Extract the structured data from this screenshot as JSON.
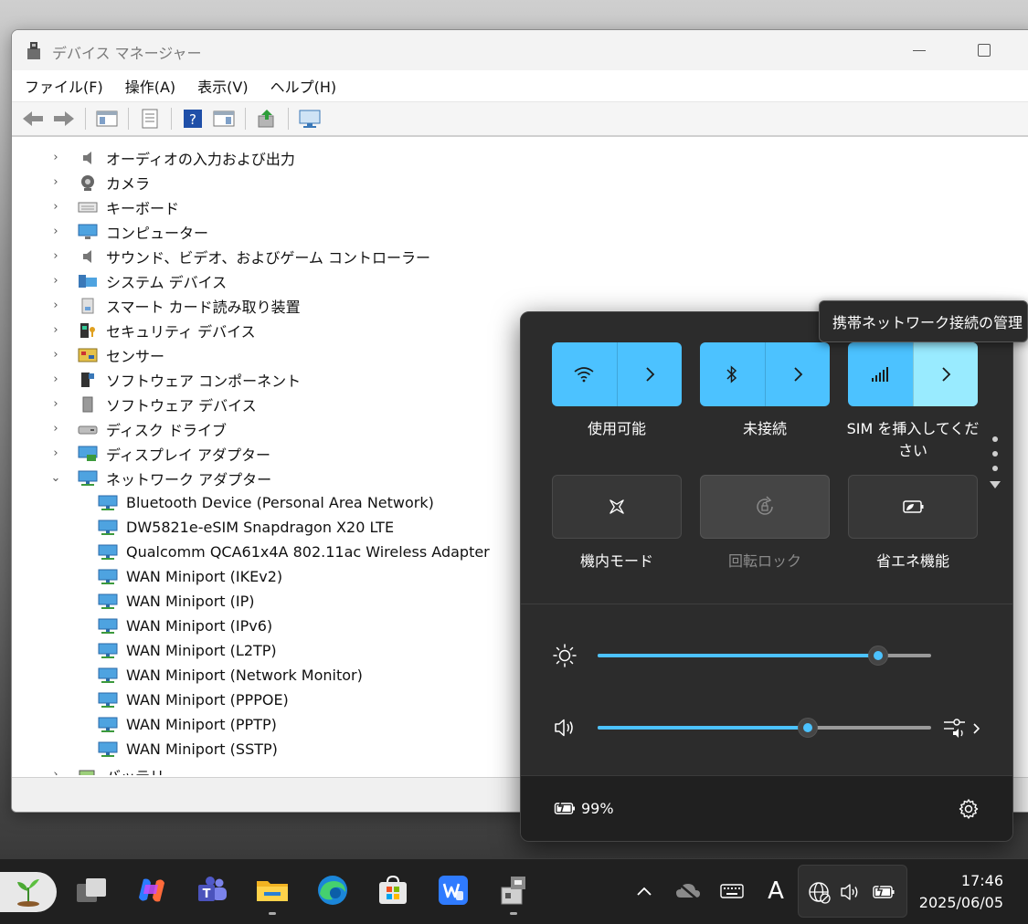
{
  "window": {
    "title": "デバイス マネージャー",
    "menu": [
      "ファイル(F)",
      "操作(A)",
      "表示(V)",
      "ヘルプ(H)"
    ]
  },
  "tree": {
    "categories": [
      "オーディオの入力および出力",
      "カメラ",
      "キーボード",
      "コンピューター",
      "サウンド、ビデオ、およびゲーム コントローラー",
      "システム デバイス",
      "スマート カード読み取り装置",
      "セキュリティ デバイス",
      "センサー",
      "ソフトウェア コンポーネント",
      "ソフトウェア デバイス",
      "ディスク ドライブ",
      "ディスプレイ アダプター",
      "ネットワーク アダプター"
    ],
    "network_adapters": [
      "Bluetooth Device (Personal Area Network)",
      "DW5821e-eSIM Snapdragon X20 LTE",
      "Qualcomm QCA61x4A 802.11ac Wireless Adapter",
      "WAN Miniport (IKEv2)",
      "WAN Miniport (IP)",
      "WAN Miniport (IPv6)",
      "WAN Miniport (L2TP)",
      "WAN Miniport (Network Monitor)",
      "WAN Miniport (PPPOE)",
      "WAN Miniport (PPTP)",
      "WAN Miniport (SSTP)"
    ],
    "partial_category": "バッテリ"
  },
  "quick_settings": {
    "tiles": [
      {
        "label": "使用可能",
        "icon": "wifi-icon",
        "state": "on"
      },
      {
        "label": "未接続",
        "icon": "bluetooth-icon",
        "state": "on"
      },
      {
        "label": "SIM を挿入してください",
        "icon": "cellular-icon",
        "state": "on"
      },
      {
        "label": "機内モード",
        "icon": "airplane-icon",
        "state": "off"
      },
      {
        "label": "回転ロック",
        "icon": "rotation-lock-icon",
        "state": "disabled"
      },
      {
        "label": "省エネ機能",
        "icon": "energy-saver-icon",
        "state": "off"
      }
    ],
    "brightness_percent": 84,
    "volume_percent": 63,
    "battery_text": "99%",
    "accent_color": "#4cc2ff"
  },
  "tooltip": "携帯ネットワーク接続の管理",
  "taskbar": {
    "time": "17:46",
    "date": "2025/06/05",
    "ime_indicator": "A"
  }
}
